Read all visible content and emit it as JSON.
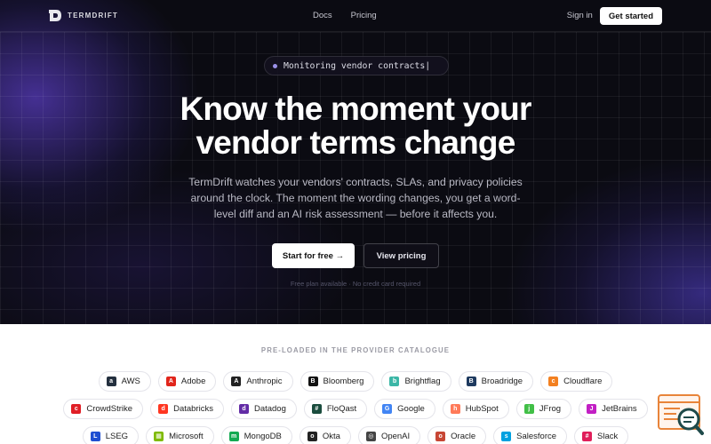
{
  "brand": {
    "name": "TERMDRIFT"
  },
  "nav": {
    "links": [
      "Docs",
      "Pricing"
    ],
    "sign_in": "Sign in",
    "get_started": "Get started"
  },
  "hero": {
    "pill_text": "Monitoring vendor contracts|",
    "headline_line1": "Know the moment your",
    "headline_line2": "vendor terms change",
    "subtitle": "TermDrift watches your vendors' contracts, SLAs, and privacy policies around the clock. The moment the wording changes, you get a word-level diff and an AI risk assessment — before it affects you.",
    "cta_primary": "Start for free →",
    "cta_secondary": "View pricing",
    "fineprint": "Free plan available · No credit card required"
  },
  "catalogue": {
    "title": "PRE-LOADED IN THE PROVIDER CATALOGUE",
    "rows": [
      [
        {
          "label": "AWS",
          "icon": "aws-icon",
          "color": "#232f3e",
          "glyph": "a"
        },
        {
          "label": "Adobe",
          "icon": "adobe-icon",
          "color": "#e1251b",
          "glyph": "A"
        },
        {
          "label": "Anthropic",
          "icon": "anthropic-icon",
          "color": "#222222",
          "glyph": "A"
        },
        {
          "label": "Bloomberg",
          "icon": "bloomberg-icon",
          "color": "#111111",
          "glyph": "B"
        },
        {
          "label": "Brightflag",
          "icon": "brightflag-icon",
          "color": "#3bb6a6",
          "glyph": "b"
        },
        {
          "label": "Broadridge",
          "icon": "broadridge-icon",
          "color": "#1e3a5f",
          "glyph": "B"
        },
        {
          "label": "Cloudflare",
          "icon": "cloudflare-icon",
          "color": "#f38020",
          "glyph": "c"
        }
      ],
      [
        {
          "label": "CrowdStrike",
          "icon": "crowdstrike-icon",
          "color": "#e01f26",
          "glyph": "c"
        },
        {
          "label": "Databricks",
          "icon": "databricks-icon",
          "color": "#ff3621",
          "glyph": "d"
        },
        {
          "label": "Datadog",
          "icon": "datadog-icon",
          "color": "#632ca6",
          "glyph": "d"
        },
        {
          "label": "FloQast",
          "icon": "floqast-icon",
          "color": "#1b4d3e",
          "glyph": "#"
        },
        {
          "label": "Google",
          "icon": "google-icon",
          "color": "#4285f4",
          "glyph": "G"
        },
        {
          "label": "HubSpot",
          "icon": "hubspot-icon",
          "color": "#ff7a59",
          "glyph": "h"
        },
        {
          "label": "JFrog",
          "icon": "jfrog-icon",
          "color": "#41bf47",
          "glyph": "j"
        },
        {
          "label": "JetBrains",
          "icon": "jetbrains-icon",
          "color": "#c21fc4",
          "glyph": "J"
        }
      ],
      [
        {
          "label": "LSEG",
          "icon": "lseg-icon",
          "color": "#1f4fd1",
          "glyph": "L"
        },
        {
          "label": "Microsoft",
          "icon": "microsoft-icon",
          "color": "#7fba00",
          "glyph": "▦"
        },
        {
          "label": "MongoDB",
          "icon": "mongodb-icon",
          "color": "#13aa52",
          "glyph": "m"
        },
        {
          "label": "Okta",
          "icon": "okta-icon",
          "color": "#222222",
          "glyph": "o"
        },
        {
          "label": "OpenAI",
          "icon": "openai-icon",
          "color": "#444444",
          "glyph": "◎"
        },
        {
          "label": "Oracle",
          "icon": "oracle-icon",
          "color": "#c74634",
          "glyph": "o"
        },
        {
          "label": "Salesforce",
          "icon": "salesforce-icon",
          "color": "#00a1e0",
          "glyph": "s"
        },
        {
          "label": "Slack",
          "icon": "slack-icon",
          "color": "#e01e5a",
          "glyph": "#"
        }
      ]
    ]
  }
}
